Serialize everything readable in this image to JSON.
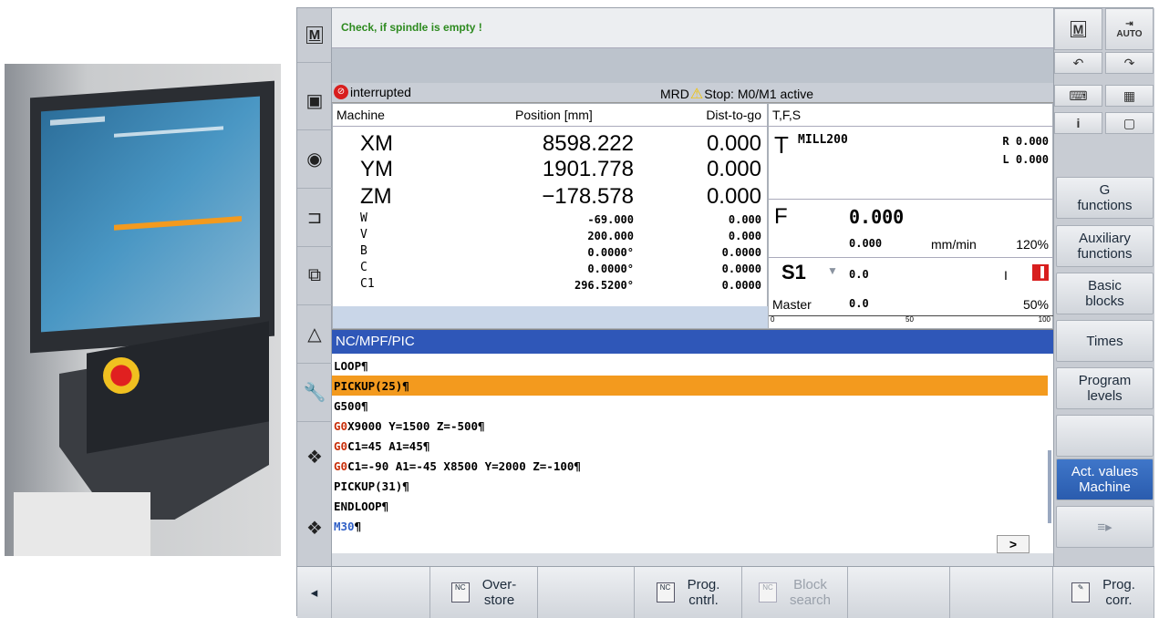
{
  "header": {
    "message": "Check, if spindle is empty !",
    "mode_icon": "M",
    "auto_label": "AUTO"
  },
  "status": {
    "state": "interrupted",
    "channel": "MRD",
    "alarm": "Stop: M0/M1 active"
  },
  "axes": {
    "headers": {
      "machine": "Machine",
      "position": "Position [mm]",
      "dist": "Dist-to-go"
    },
    "rows": [
      {
        "name": "XM",
        "pos": "8598.222",
        "dist": "0.000"
      },
      {
        "name": "YM",
        "pos": "1901.778",
        "dist": "0.000"
      },
      {
        "name": "ZM",
        "pos": "−178.578",
        "dist": "0.000"
      },
      {
        "name": "W",
        "pos": "-69.000",
        "dist": "0.000"
      },
      {
        "name": "V",
        "pos": "200.000",
        "dist": "0.000"
      },
      {
        "name": "B",
        "pos": "0.0000°",
        "dist": "0.0000"
      },
      {
        "name": "C",
        "pos": "0.0000°",
        "dist": "0.0000"
      },
      {
        "name": "C1",
        "pos": "296.5200°",
        "dist": "0.0000"
      }
    ]
  },
  "tfs": {
    "header": "T,F,S",
    "tool_label": "T",
    "tool_name": "MILL200",
    "radius": "R 0.000",
    "length": "L 0.000",
    "feed_label": "F",
    "feed_value": "0.000",
    "feed_actual": "0.000",
    "feed_unit": "mm/min",
    "feed_override": "120%",
    "spindle_label": "S1",
    "spindle_value": "0.0",
    "spindle_dir": "I",
    "master_label": "Master",
    "master_value": "0.0",
    "master_override": "50%",
    "scale_min": "0",
    "scale_mid": "50",
    "scale_max": "100"
  },
  "program": {
    "title": "NC/MPF/PIC",
    "lines": [
      {
        "g": "",
        "text": "LOOP¶"
      },
      {
        "g": "",
        "text": "PICKUP(25)¶"
      },
      {
        "g": "",
        "text": "G500¶"
      },
      {
        "g": "G0",
        "text": " X9000 Y=1500 Z=-500¶"
      },
      {
        "g": "G0",
        "text": " C1=45 A1=45¶"
      },
      {
        "g": "G0",
        "text": " C1=-90 A1=-45 X8500 Y=2000 Z=-100¶"
      },
      {
        "g": "",
        "text": "PICKUP(31)¶"
      },
      {
        "g": "",
        "text": "ENDLOOP¶"
      },
      {
        "g": "M30",
        "text": "¶"
      }
    ],
    "scroll_right": ">"
  },
  "softkeys": {
    "g_functions": "G\nfunctions",
    "aux_functions": "Auxiliary\nfunctions",
    "basic_blocks": "Basic\nblocks",
    "times": "Times",
    "program_levels": "Program\nlevels",
    "act_values": "Act. values\nMachine"
  },
  "hkeys": {
    "back": "◂",
    "overstore": "Over-\nstore",
    "prog_cntrl": "Prog.\ncntrl.",
    "block_search": "Block\nsearch",
    "prog_corr": "Prog.\ncorr."
  },
  "colors": {
    "highlight": "#f39a1e",
    "program_title_bg": "#2f57b8",
    "active_softkey": "#2f63b6",
    "alarm_yellow": "#f2c200",
    "stop_red": "#d81e1e"
  }
}
